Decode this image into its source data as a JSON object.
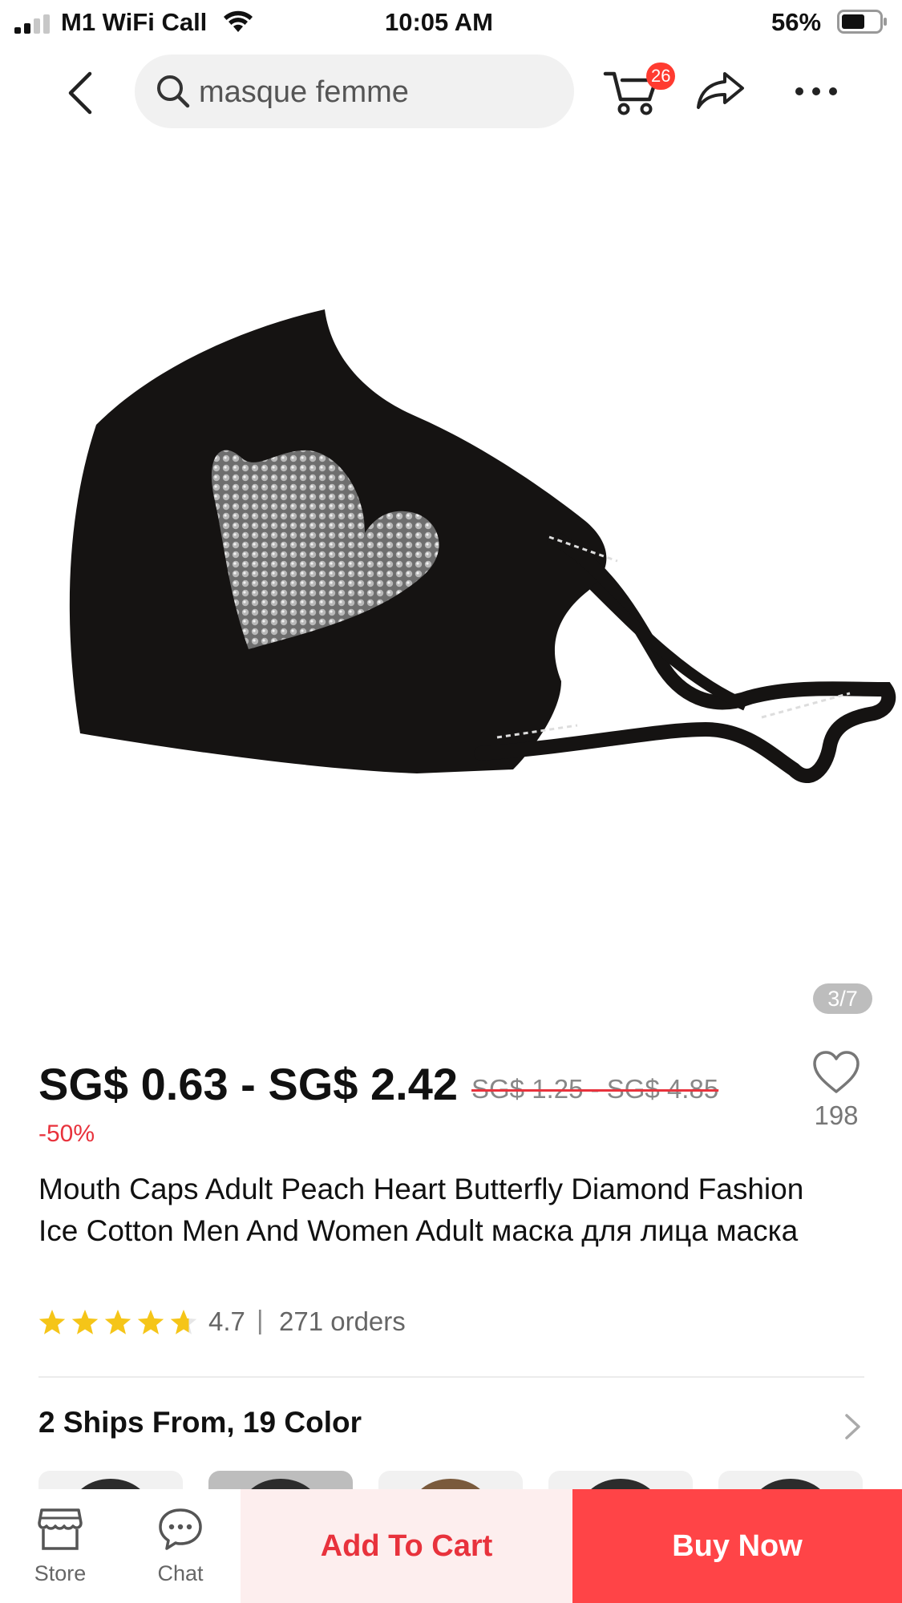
{
  "status_bar": {
    "carrier": "M1 WiFi Call",
    "time": "10:05 AM",
    "battery": "56%"
  },
  "nav": {
    "search_text": "masque femme",
    "cart_count": "26",
    "icons": [
      "back-icon",
      "search-icon",
      "cart-icon",
      "share-icon",
      "more-icon"
    ]
  },
  "gallery": {
    "counter": "3/7"
  },
  "product": {
    "price": "SG$ 0.63 - SG$ 2.42",
    "original_price": "SG$ 1.25 - SG$ 4.85",
    "discount": "-50%",
    "wishlist_count": "198",
    "title": "Mouth Caps Adult Peach Heart Butterfly Diamond Fashion Ice Cotton Men And Women Adult маска для лица маска",
    "rating": "4.7",
    "rating_value": 4.7,
    "rating_max": 5,
    "separator": "|",
    "orders": "271 orders"
  },
  "variants": {
    "summary": "2 Ships From, 19 Color"
  },
  "bottom_bar": {
    "store_label": "Store",
    "chat_label": "Chat",
    "add_to_cart": "Add To Cart",
    "buy_now": "Buy Now"
  },
  "colors": {
    "accent": "#e8323c",
    "buy_now_bg": "#ff4447",
    "add_cart_bg": "#fdeeee",
    "star": "#f5c518",
    "badge": "#ff3b30"
  }
}
